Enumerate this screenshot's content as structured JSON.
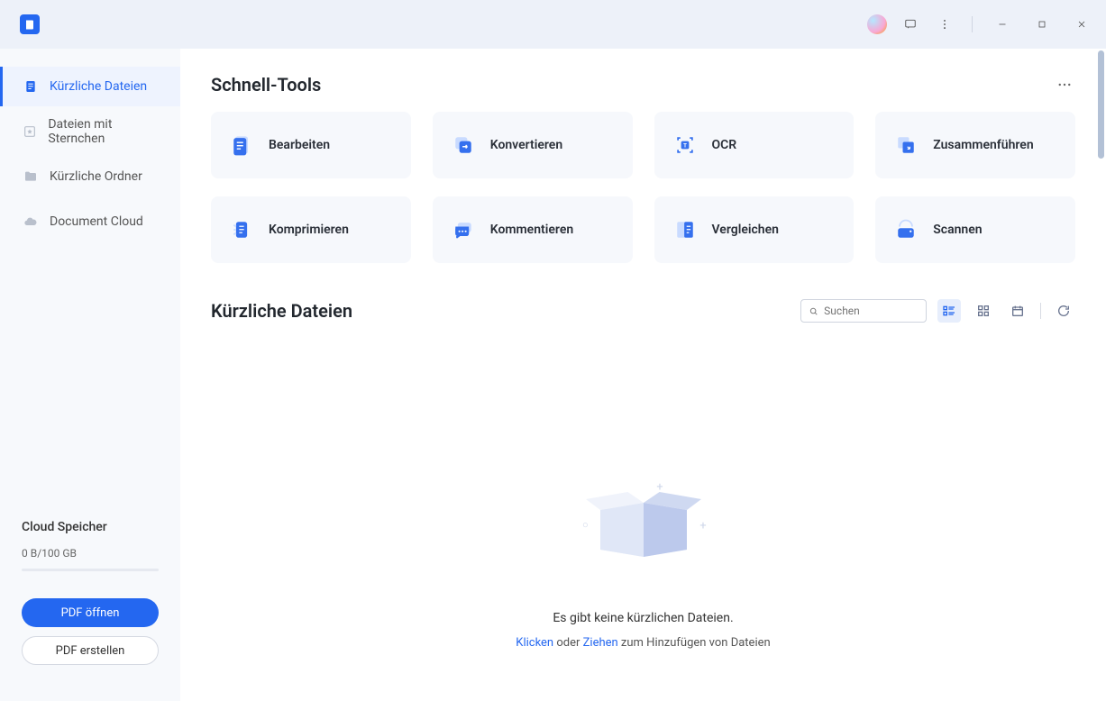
{
  "titlebar": {},
  "sidebar": {
    "items": [
      {
        "label": "Kürzliche Dateien"
      },
      {
        "label": "Dateien mit Sternchen"
      },
      {
        "label": "Kürzliche Ordner"
      },
      {
        "label": "Document Cloud"
      }
    ],
    "storage": {
      "title": "Cloud Speicher",
      "value": "0 B/100 GB"
    },
    "buttons": {
      "open_pdf": "PDF öffnen",
      "create_pdf": "PDF erstellen"
    }
  },
  "main": {
    "quick_tools_title": "Schnell-Tools",
    "tools": [
      {
        "label": "Bearbeiten",
        "icon": "edit"
      },
      {
        "label": "Konvertieren",
        "icon": "convert"
      },
      {
        "label": "OCR",
        "icon": "ocr"
      },
      {
        "label": "Zusammenführen",
        "icon": "merge"
      },
      {
        "label": "Komprimieren",
        "icon": "compress"
      },
      {
        "label": "Kommentieren",
        "icon": "comment"
      },
      {
        "label": "Vergleichen",
        "icon": "compare"
      },
      {
        "label": "Scannen",
        "icon": "scan"
      }
    ],
    "recent_title": "Kürzliche Dateien",
    "search_placeholder": "Suchen",
    "empty": {
      "headline": "Es gibt keine kürzlichen Dateien.",
      "link1": "Klicken",
      "middle": " oder ",
      "link2": "Ziehen",
      "tail": " zum Hinzufügen von Dateien"
    }
  }
}
